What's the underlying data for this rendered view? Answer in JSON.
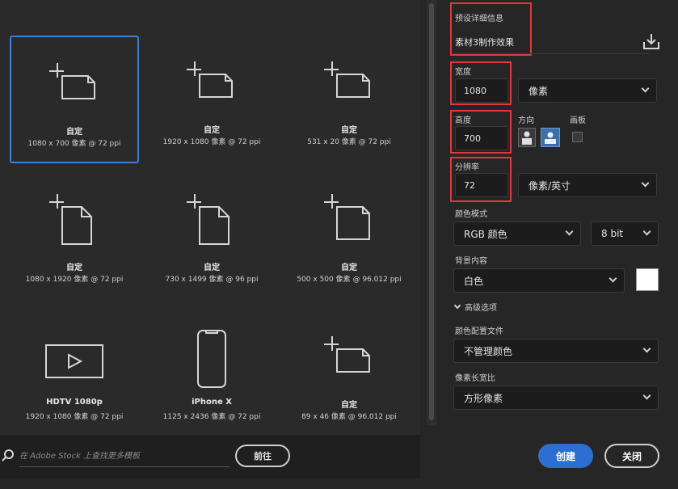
{
  "presets": [
    {
      "name": "自定",
      "dims": "1080 x 700 像素 @ 72 ppi",
      "icon": "blank-document-icon",
      "selected": true
    },
    {
      "name": "自定",
      "dims": "1920 x 1080 像素 @ 72 ppi",
      "icon": "blank-document-icon"
    },
    {
      "name": "自定",
      "dims": "531 x 20 像素 @ 72 ppi",
      "icon": "blank-document-icon"
    },
    {
      "name": "自定",
      "dims": "1080 x 1920 像素 @ 72 ppi",
      "icon": "blank-document-icon"
    },
    {
      "name": "自定",
      "dims": "730 x 1499 像素 @ 96 ppi",
      "icon": "blank-document-icon"
    },
    {
      "name": "自定",
      "dims": "500 x 500 像素 @ 96.012 ppi",
      "icon": "blank-document-icon"
    },
    {
      "name": "HDTV 1080p",
      "dims": "1920 x 1080 像素 @ 72 ppi",
      "icon": "video-play-icon"
    },
    {
      "name": "iPhone X",
      "dims": "1125 x 2436 像素 @ 72 ppi",
      "icon": "phone-icon"
    },
    {
      "name": "自定",
      "dims": "89 x 46 像素 @ 96.012 ppi",
      "icon": "blank-document-icon"
    }
  ],
  "search": {
    "placeholder": "在 Adobe Stock 上查找更多模板",
    "go_label": "前往"
  },
  "details": {
    "header": "预设详细信息",
    "preset_name": "素材3制作效果",
    "width_label": "宽度",
    "width_value": "1080",
    "width_unit": "像素",
    "height_label": "高度",
    "height_value": "700",
    "orientation_label": "方向",
    "artboard_label": "画板",
    "resolution_label": "分辨率",
    "resolution_value": "72",
    "resolution_unit": "像素/英寸",
    "color_mode_label": "颜色模式",
    "color_mode": "RGB 颜色",
    "bit_depth": "8 bit",
    "background_label": "背景内容",
    "background": "白色",
    "background_swatch": "#ffffff",
    "advanced_label": "高级选项",
    "color_profile_label": "颜色配置文件",
    "color_profile": "不管理颜色",
    "pixel_aspect_label": "像素长宽比",
    "pixel_aspect": "方形像素"
  },
  "actions": {
    "create_label": "创建",
    "close_label": "关闭"
  },
  "colors": {
    "accent": "#2d6fd1",
    "highlight": "#e0383e",
    "selection": "#3f7ed8"
  }
}
